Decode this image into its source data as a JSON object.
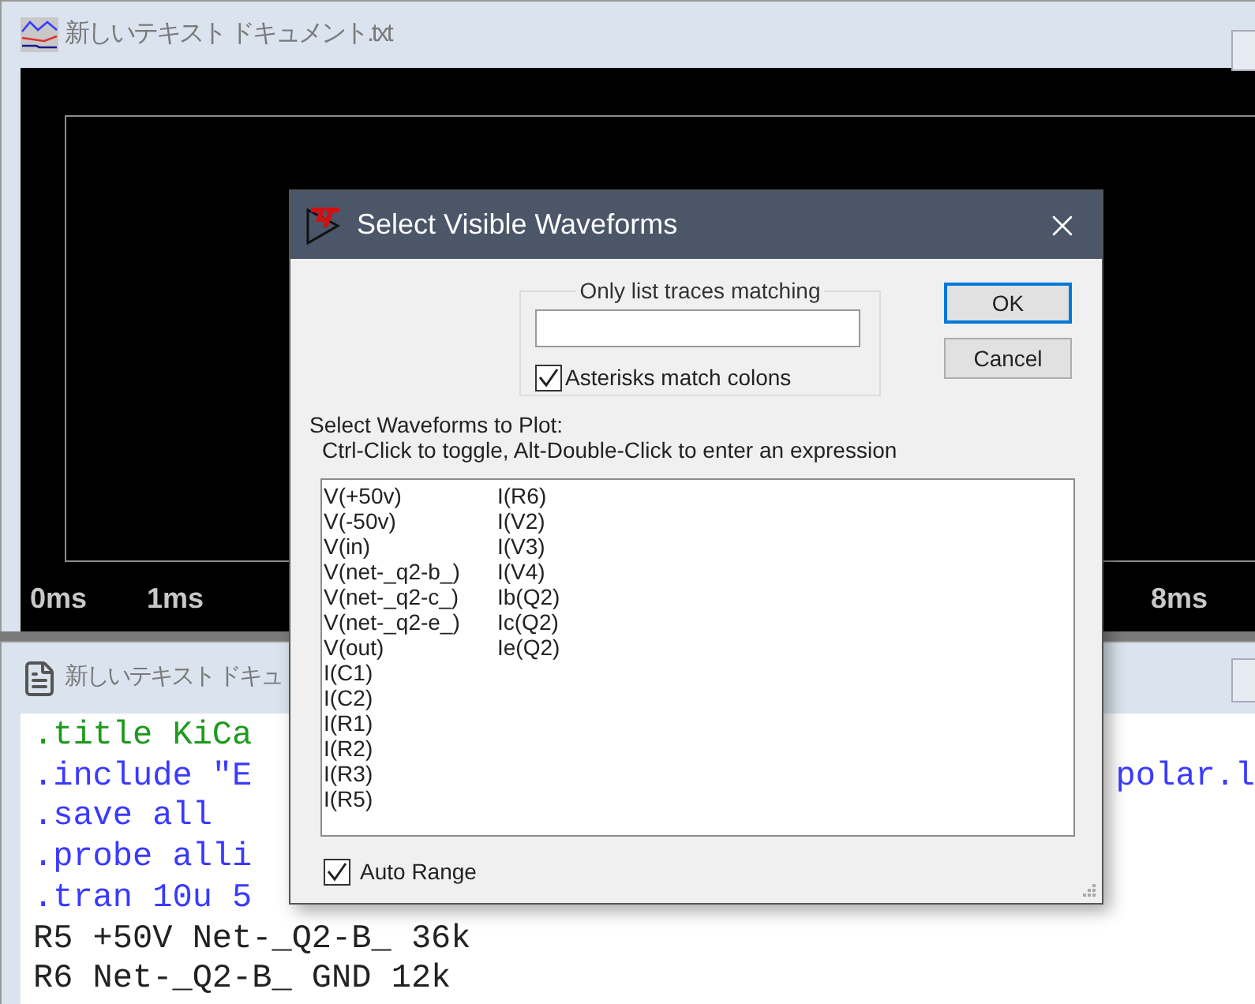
{
  "waveform_window": {
    "title": "新しいテキスト ドキュメント.txt",
    "time_ticks": [
      "0ms",
      "1ms",
      "8ms"
    ]
  },
  "text_window": {
    "title": "新しいテキスト ドキュ",
    "lines": [
      {
        "kind": "title",
        "text": ".title KiCa"
      },
      {
        "kind": "directive",
        "text": ".include \"E",
        "tail": "polar.l"
      },
      {
        "kind": "directive",
        "text": ".save all"
      },
      {
        "kind": "directive",
        "text": ".probe alli"
      },
      {
        "kind": "directive",
        "text": ".tran 10u 5"
      },
      {
        "kind": "element",
        "text": "R5 +50V Net-_Q2-B_ 36k"
      },
      {
        "kind": "element",
        "text": "R6 Net-_Q2-B_ GND 12k"
      }
    ]
  },
  "dialog": {
    "title": "Select Visible Waveforms",
    "filter_group": {
      "legend": "Only list traces matching",
      "asterisks": {
        "label": "Asterisks match colons",
        "checked": true
      }
    },
    "buttons": [
      {
        "label": "OK",
        "default": true
      },
      {
        "label": "Cancel",
        "default": false
      }
    ],
    "instructions": [
      "Select Waveforms to Plot:",
      "Ctrl-Click to toggle, Alt-Double-Click to enter an expression"
    ],
    "traces": [
      "V(+50v)",
      "V(-50v)",
      "V(in)",
      "V(net-_q2-b_)",
      "V(net-_q2-c_)",
      "V(net-_q2-e_)",
      "V(out)",
      "I(C1)",
      "I(C2)",
      "I(R1)",
      "I(R2)",
      "I(R3)",
      "I(R5)",
      "I(R6)",
      "I(V2)",
      "I(V3)",
      "I(V4)",
      "Ib(Q2)",
      "Ic(Q2)",
      "Ie(Q2)"
    ],
    "auto_range": {
      "label": "Auto Range",
      "checked": true
    }
  }
}
